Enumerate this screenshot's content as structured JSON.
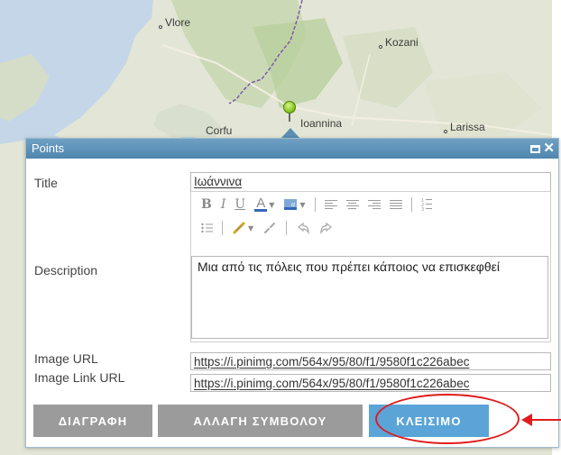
{
  "map": {
    "labels": {
      "vlore": "Vlore",
      "kozani": "Kozani",
      "corfu": "Corfu",
      "ioannina": "Ioannina",
      "larissa": "Larissa"
    },
    "colors": {
      "land": "#e3e6d6",
      "sea": "#c4d6e8",
      "forest": "#b9cf9e",
      "border": "#7d5aa8"
    }
  },
  "popup": {
    "title": "Points",
    "colors": {
      "header": "#5a8eb3",
      "close_button": "#5aa4d8",
      "neutral_button": "#9b9b9b"
    },
    "fields": {
      "title_label": "Title",
      "title_value": "Ιωάννινα",
      "description_label": "Description",
      "description_value": "Μια από τις πόλεις που πρέπει κάποιος να επισκεφθεί",
      "image_url_label": "Image URL",
      "image_url_value": "https://i.pinimg.com/564x/95/80/f1/9580f1c226abec",
      "image_link_url_label": "Image Link URL",
      "image_link_url_value": "https://i.pinimg.com/564x/95/80/f1/9580f1c226abec"
    },
    "toolbar": {
      "bold": "B",
      "italic": "I",
      "underline": "U",
      "font_color": "A"
    },
    "buttons": {
      "delete": "ΔΙΑΓΡΑΦΗ",
      "change_symbol": "ΑΛΛΑΓΗ ΣΥΜΒΟΛΟΥ",
      "close": "ΚΛΕΙΣΙΜΟ"
    }
  },
  "annotation": {
    "color": "#e01b1b"
  }
}
